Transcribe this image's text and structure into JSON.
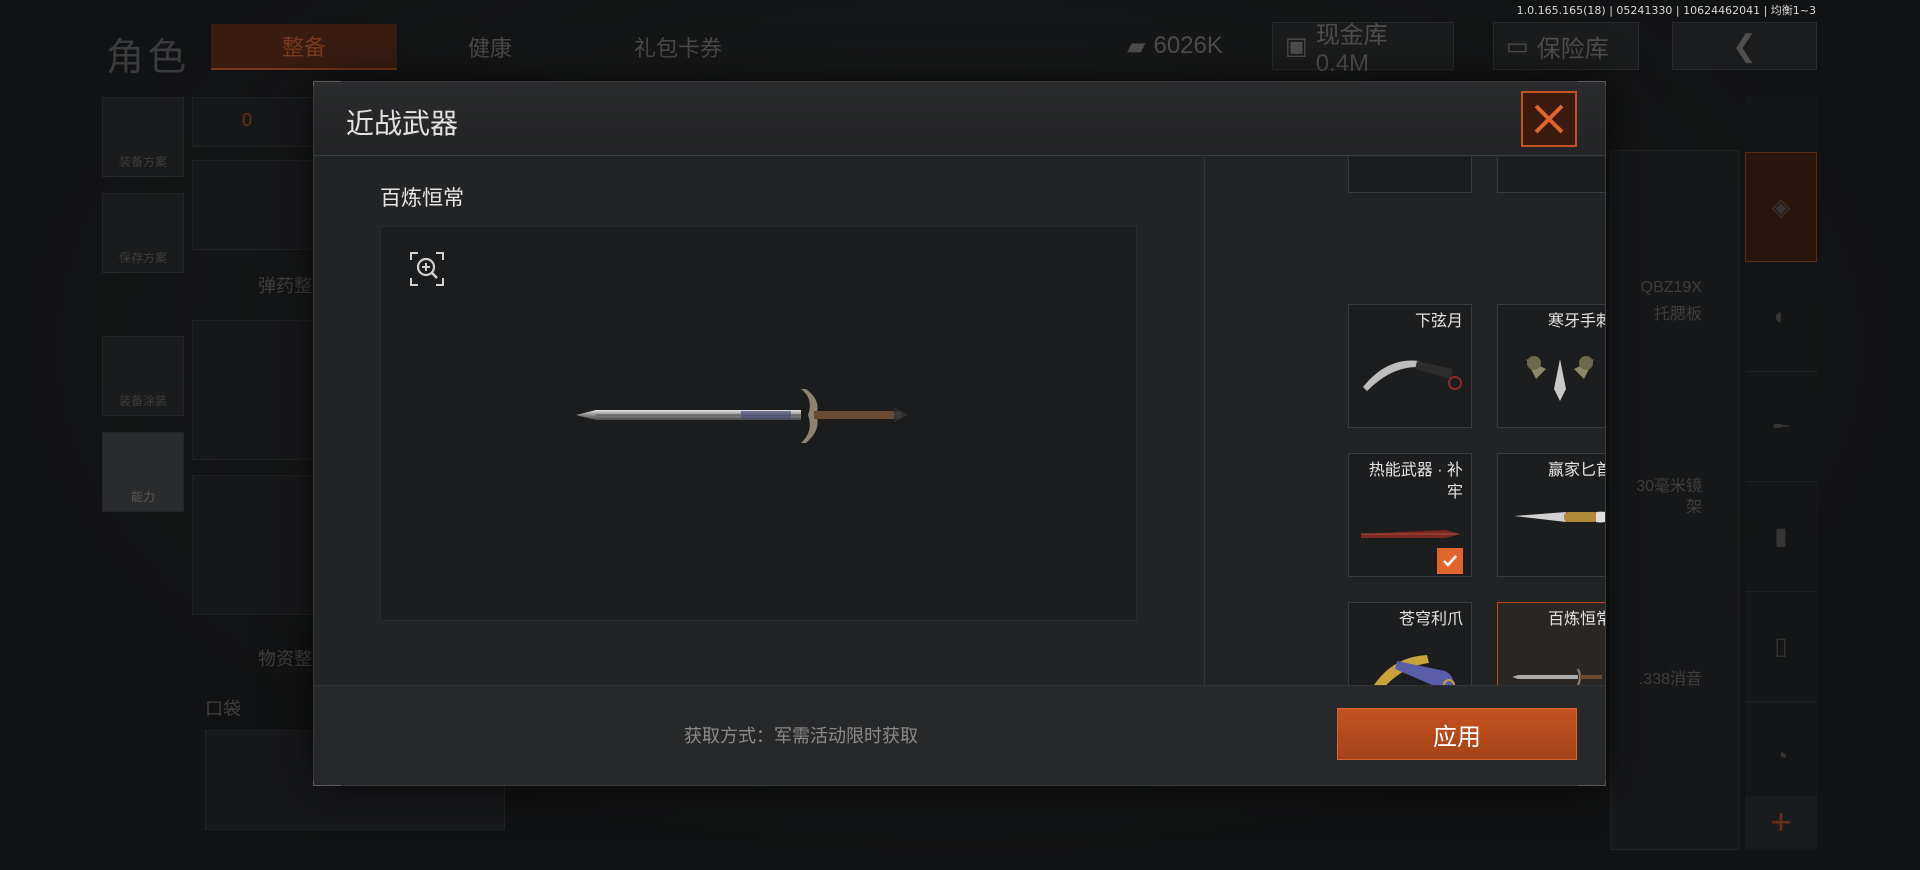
{
  "version": "1.0.165.165(18) | 05241330 | 10624462041 | 均衡1~3",
  "background": {
    "title": "角色",
    "tabs": [
      "整备",
      "健康",
      "礼包卡券"
    ],
    "money": "6026K",
    "cash_store": "现金库 0.4M",
    "safe": "保险库",
    "side_items": [
      "装备方案",
      "保存方案",
      "装备涂装",
      "能力"
    ],
    "backpack_count": "0",
    "ammo_label": "弹药整",
    "supply_label": "物资整",
    "pocket_label": "口袋",
    "weapon_texts": [
      "QBZ19X",
      "托腮板",
      "30毫米镜",
      "架",
      ".338消音"
    ]
  },
  "modal": {
    "title": "近战武器",
    "preview_name": "百炼恒常",
    "items": [
      {
        "name": "下弦月",
        "equipped": false,
        "selected": false
      },
      {
        "name": "寒牙手刺",
        "equipped": false,
        "selected": false
      },
      {
        "name": "热能武器 · 补牢",
        "equipped": true,
        "selected": false
      },
      {
        "name": "赢家匕首",
        "equipped": false,
        "selected": false
      },
      {
        "name": "苍穹利爪",
        "equipped": false,
        "selected": false
      },
      {
        "name": "百炼恒常",
        "equipped": false,
        "selected": true
      }
    ],
    "acquire_text": "获取方式：军需活动限时获取",
    "apply_label": "应用"
  },
  "colors": {
    "accent": "#c4521f",
    "check": "#e0652a",
    "panel": "#232425"
  }
}
